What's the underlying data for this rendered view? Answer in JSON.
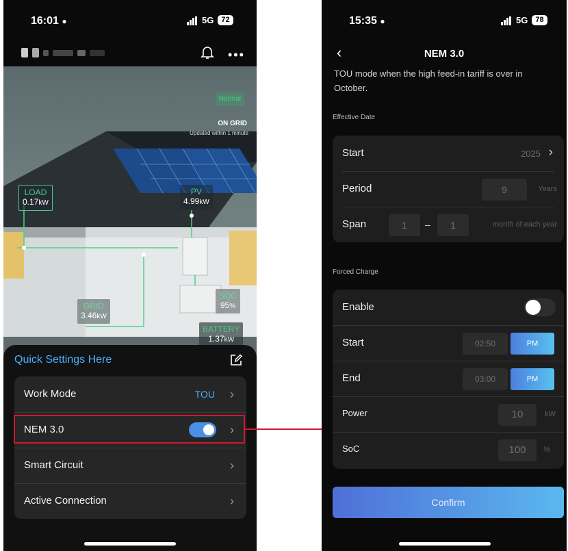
{
  "left_phone": {
    "status": {
      "time": "16:01",
      "network": "5G",
      "battery": "72"
    },
    "scene": {
      "status_badge": "Normal",
      "grid_state": "ON GRID",
      "updated": "Updated  within 1 minute",
      "load": {
        "label": "LOAD",
        "value": "0.17",
        "unit": "kW"
      },
      "pv": {
        "label": "PV",
        "value": "4.99",
        "unit": "kW"
      },
      "grid": {
        "label": "GRID",
        "value": "3.46",
        "unit": "kW"
      },
      "soc": {
        "label": "SOC",
        "value": "95",
        "unit": "%"
      },
      "battery": {
        "label": "BATTERY",
        "value": "1.37",
        "unit": "kW"
      }
    },
    "quick_settings": {
      "title": "Quick Settings Here",
      "items": [
        {
          "label": "Work Mode",
          "value": "TOU"
        },
        {
          "label": "NEM 3.0",
          "toggle": true
        },
        {
          "label": "Smart Circuit"
        },
        {
          "label": "Active Connection"
        }
      ]
    }
  },
  "right_phone": {
    "status": {
      "time": "15:35",
      "network": "5G",
      "battery": "78"
    },
    "title": "NEM 3.0",
    "intro_text": "TOU mode when the high feed-in tariff is over in October.",
    "effective_date": {
      "section_label": "Effective Date",
      "start_label": "Start",
      "start_value": "2025",
      "period_label": "Period",
      "period_value": "9",
      "period_unit": "Years",
      "span_label": "Span",
      "span_from": "1",
      "span_dash": "–",
      "span_to": "1",
      "span_unit": "month of each year"
    },
    "forced_charge": {
      "section_label": "Forced Charge",
      "enable_label": "Enable",
      "enable_on": false,
      "start_label": "Start",
      "start_time": "02:50",
      "start_ampm": "PM",
      "end_label": "End",
      "end_time": "03:00",
      "end_ampm": "PM",
      "power_label": "Power",
      "power_value": "10",
      "power_unit": "kW",
      "soc_label": "SoC",
      "soc_value": "100",
      "soc_unit": "%"
    },
    "confirm_label": "Confirm"
  },
  "colors": {
    "highlight": "#d0182c",
    "accent": "#4a8fe6",
    "tou": "#4ab0ff"
  }
}
